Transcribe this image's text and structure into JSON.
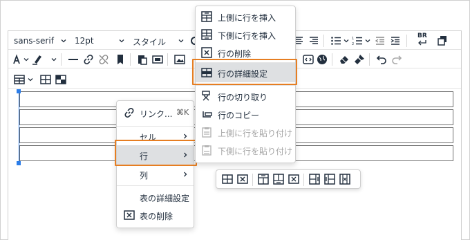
{
  "toolbar": {
    "font_family": "sans-serif",
    "font_size": "12pt",
    "styles_label": "スタイル",
    "rtl_label": "BR"
  },
  "context_menu": {
    "items": [
      {
        "label": "リンク...",
        "shortcut": "⌘K",
        "icon": "link-icon"
      },
      {
        "label": "セル",
        "submenu": true
      },
      {
        "label": "行",
        "submenu": true,
        "active": true
      },
      {
        "label": "列",
        "submenu": true
      },
      {
        "label": "表の詳細設定"
      },
      {
        "label": "表の削除",
        "icon": "table-delete-icon"
      }
    ]
  },
  "row_submenu": {
    "items": [
      {
        "label": "上側に行を挿入",
        "icon": "row-insert-before-icon",
        "disabled": false
      },
      {
        "label": "下側に行を挿入",
        "icon": "row-insert-after-icon",
        "disabled": false
      },
      {
        "label": "行の削除",
        "icon": "row-delete-icon",
        "disabled": false
      },
      {
        "label": "行の詳細設定",
        "icon": "row-properties-icon",
        "disabled": false,
        "highlighted": true
      },
      {
        "label": "行の切り取り",
        "icon": "cut-row-icon",
        "disabled": false
      },
      {
        "label": "行のコピー",
        "icon": "copy-row-icon",
        "disabled": false
      },
      {
        "label": "上側に行を貼り付け",
        "icon": "paste-row-before-icon",
        "disabled": true
      },
      {
        "label": "下側に行を貼り付け",
        "icon": "paste-row-after-icon",
        "disabled": true
      }
    ]
  },
  "colors": {
    "highlight_border": "#e67e22",
    "selection": "#2b7de9",
    "menu_hover": "#dee0e2",
    "disabled_text": "#a6a6a6"
  }
}
